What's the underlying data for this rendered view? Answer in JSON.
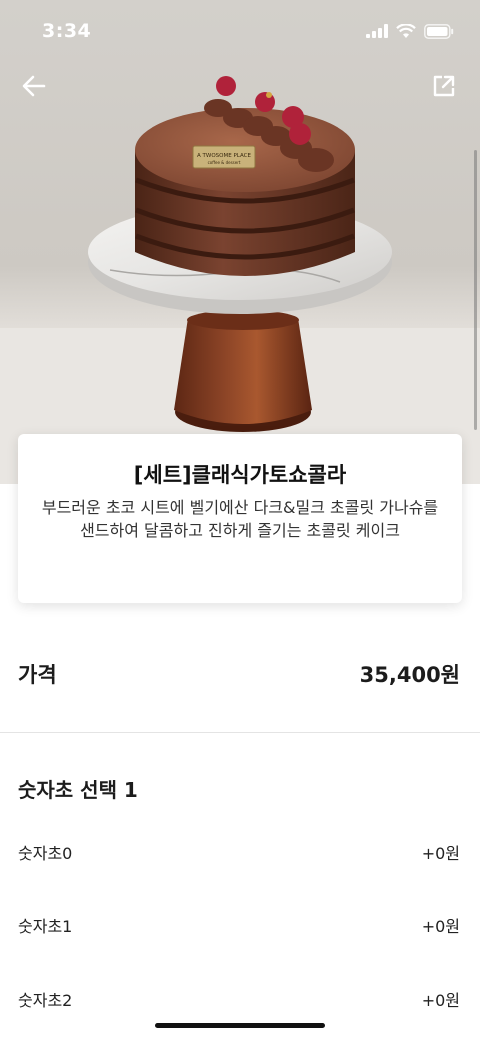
{
  "status_bar": {
    "time": "3:34"
  },
  "product": {
    "plaque_line1": "A TWOSOME PLACE",
    "plaque_line2": "coffee & dessert",
    "title": "[세트]클래식가토쇼콜라",
    "description": "부드러운 초코 시트에 벨기에산 다크&밀크 초콜릿 가나슈를 샌드하여 달콤하고 진하게 즐기는 초콜릿 케이크"
  },
  "price": {
    "label": "가격",
    "value": "35,400원"
  },
  "options": {
    "title": "숫자초 선택 1",
    "items": [
      {
        "name": "숫자초0",
        "price": "+0원"
      },
      {
        "name": "숫자초1",
        "price": "+0원"
      },
      {
        "name": "숫자초2",
        "price": "+0원"
      }
    ]
  },
  "colors": {
    "background": "#ffffff",
    "text": "#1c1c1c",
    "divider": "#e4e4e4",
    "cake_brown": "#6b3b28",
    "stand_wood": "#7a3a22"
  },
  "icons": {
    "back": "arrow-left-icon",
    "share": "share-icon",
    "signal": "signal-icon",
    "wifi": "wifi-icon",
    "battery": "battery-icon"
  }
}
